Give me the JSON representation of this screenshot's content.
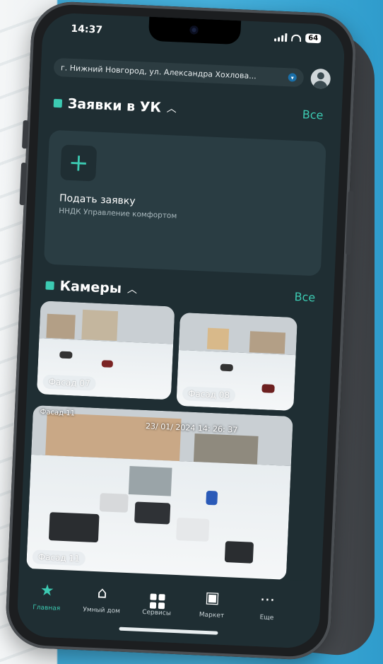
{
  "status": {
    "time": "14:37",
    "battery": "64"
  },
  "address": {
    "text": "г. Нижний Новгород, ул. Александра Хохлова..."
  },
  "requests": {
    "title": "Заявки в УК",
    "all": "Все",
    "card_label": "Подать заявку",
    "card_sub": "ННДК Управление комфортом"
  },
  "cameras": {
    "title": "Камеры",
    "all": "Все",
    "items": [
      {
        "label": "Фасад 07"
      },
      {
        "label": "Фасад 08"
      },
      {
        "label": "Фасад 11",
        "overlay_name": "Фасад 11",
        "timestamp": "23/ 01/ 2024  14: 26: 37"
      }
    ]
  },
  "tabbar": {
    "items": [
      {
        "label": "Главная",
        "icon": "star-icon"
      },
      {
        "label": "Умный дом",
        "icon": "house-icon"
      },
      {
        "label": "Сервисы",
        "icon": "grid-icon"
      },
      {
        "label": "Маркет",
        "icon": "bag-icon"
      },
      {
        "label": "Еще",
        "icon": "more-icon"
      }
    ]
  },
  "colors": {
    "accent": "#3ccab2",
    "background": "#1f2e33",
    "card": "#2a3d43"
  }
}
